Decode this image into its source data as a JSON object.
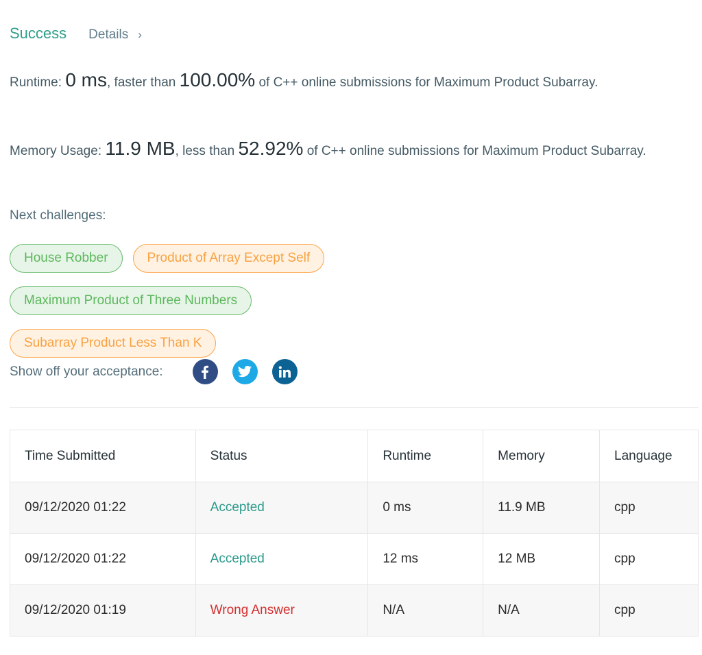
{
  "header": {
    "status": "Success",
    "details_label": "Details",
    "details_chevron": "›"
  },
  "runtime": {
    "label": "Runtime: ",
    "value": "0 ms",
    "mid": ", faster than ",
    "percent": "100.00%",
    "tail": " of C++ online submissions for Maximum Product Subarray."
  },
  "memory": {
    "label": "Memory Usage: ",
    "value": "11.9 MB",
    "mid": ", less than ",
    "percent": "52.92%",
    "tail": " of C++ online submissions for Maximum Product Subarray."
  },
  "next_challenges": {
    "label": "Next challenges:",
    "items": [
      {
        "label": "House Robber",
        "difficulty": "easy"
      },
      {
        "label": "Product of Array Except Self",
        "difficulty": "medium"
      },
      {
        "label": "Maximum Product of Three Numbers",
        "difficulty": "easy"
      },
      {
        "label": "Subarray Product Less Than K",
        "difficulty": "medium"
      }
    ]
  },
  "share": {
    "label": "Show off your acceptance:",
    "icons": [
      "facebook-icon",
      "twitter-icon",
      "linkedin-icon"
    ]
  },
  "colors": {
    "success": "#2f9e8a",
    "accepted": "#2b9a8a",
    "wrong_answer": "#d32f2f",
    "easy": "#5cb85c",
    "medium": "#f8a141",
    "facebook": "#2f4d84",
    "twitter": "#1da8e6",
    "linkedin": "#0b6293"
  },
  "table": {
    "headers": [
      "Time Submitted",
      "Status",
      "Runtime",
      "Memory",
      "Language"
    ],
    "rows": [
      {
        "time": "09/12/2020 01:22",
        "status": "Accepted",
        "runtime": "0 ms",
        "memory": "11.9 MB",
        "language": "cpp"
      },
      {
        "time": "09/12/2020 01:22",
        "status": "Accepted",
        "runtime": "12 ms",
        "memory": "12 MB",
        "language": "cpp"
      },
      {
        "time": "09/12/2020 01:19",
        "status": "Wrong Answer",
        "runtime": "N/A",
        "memory": "N/A",
        "language": "cpp"
      }
    ]
  }
}
